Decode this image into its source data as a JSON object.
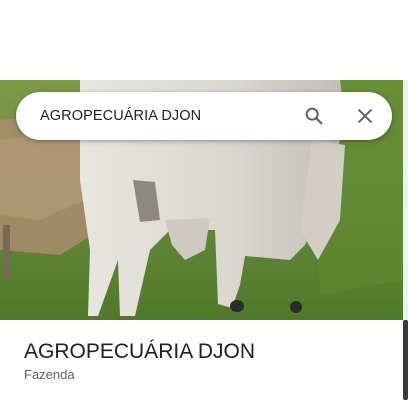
{
  "search": {
    "query": "AGROPECUÁRIA DJON"
  },
  "icons": {
    "search": "search-icon",
    "close": "close-icon"
  },
  "place": {
    "name": "AGROPECUÁRIA DJON",
    "category": "Fazenda"
  },
  "colors": {
    "title_text": "#202124",
    "secondary_text": "#5f6368",
    "icon": "#5f6368",
    "grass": "#6f8f3a"
  }
}
